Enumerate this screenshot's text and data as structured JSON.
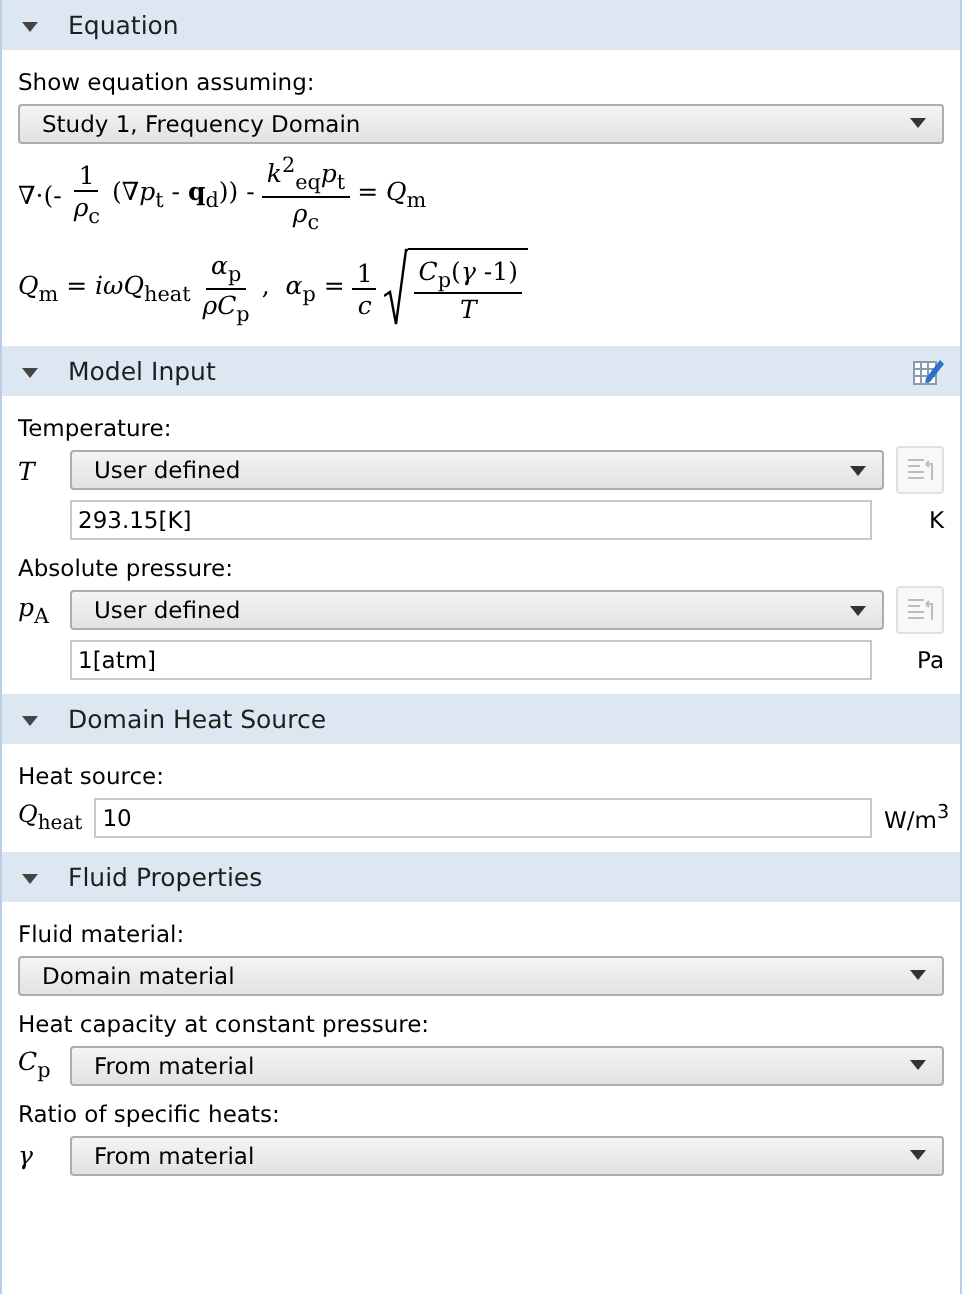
{
  "sections": [
    {
      "title": "Equation",
      "expanded": true,
      "rows": [
        {
          "kind": "label",
          "text": "Show equation assuming:"
        },
        {
          "kind": "select",
          "value": "Study 1, Frequency Domain"
        },
        {
          "kind": "equation",
          "parts": [
            {
              "kind": "text",
              "text": "∇·(-"
            },
            {
              "kind": "frac",
              "num": "1",
              "den": "*ρ*$_{c}$"
            },
            {
              "kind": "text",
              "text": "(∇*p*$_{t}$ - **q**$_{d}$)) -"
            },
            {
              "kind": "frac",
              "num": "*k*$^{2}$$_{eq}$*p*$_{t}$",
              "den": "*ρ*$_{c}$"
            },
            {
              "kind": "text",
              "text": "= *Q*$_{m}$"
            }
          ]
        },
        {
          "kind": "equation",
          "parts": [
            {
              "kind": "text",
              "text": "*Q*$_{m}$ = *iωQ*$_{heat}$"
            },
            {
              "kind": "frac",
              "num": "*α*$_{p}$",
              "den": "*ρC*$_{p}$"
            },
            {
              "kind": "text",
              "text": ",  *α*$_{p}$ ="
            },
            {
              "kind": "frac",
              "num": "1",
              "den": "*c*"
            },
            {
              "kind": "sqrt",
              "parts": [
                {
                  "kind": "frac",
                  "num": "*C*$_{p}$(*γ* -1)",
                  "den": "*T*"
                }
              ]
            }
          ]
        }
      ]
    },
    {
      "title": "Model Input",
      "expanded": true,
      "edit_icon": true,
      "rows": [
        {
          "kind": "label",
          "text": "Temperature:"
        },
        {
          "kind": "symbol-select",
          "symbol": "*T*",
          "value": "User defined",
          "side_button_disabled": true
        },
        {
          "kind": "field",
          "value": "293.15[K]",
          "unit": "K"
        },
        {
          "kind": "label",
          "text": "Absolute pressure:"
        },
        {
          "kind": "symbol-select",
          "symbol": "*p*$_{A}$",
          "value": "User defined",
          "side_button_disabled": true
        },
        {
          "kind": "field",
          "value": "1[atm]",
          "unit": "Pa"
        }
      ]
    },
    {
      "title": "Domain Heat Source",
      "expanded": true,
      "rows": [
        {
          "kind": "label",
          "text": "Heat source:"
        },
        {
          "kind": "symbol-field",
          "symbol": "*Q*$_{heat}$",
          "value": "10",
          "unit": "W/m$^{3}$"
        }
      ]
    },
    {
      "title": "Fluid Properties",
      "expanded": true,
      "rows": [
        {
          "kind": "label",
          "text": "Fluid material:"
        },
        {
          "kind": "select",
          "value": "Domain material"
        },
        {
          "kind": "label",
          "text": "Heat capacity at constant pressure:"
        },
        {
          "kind": "symbol-select",
          "symbol": "*C*$_{p}$",
          "value": "From material"
        },
        {
          "kind": "label",
          "text": "Ratio of specific heats:"
        },
        {
          "kind": "symbol-select",
          "symbol": "*γ*",
          "value": "From material"
        }
      ]
    }
  ]
}
